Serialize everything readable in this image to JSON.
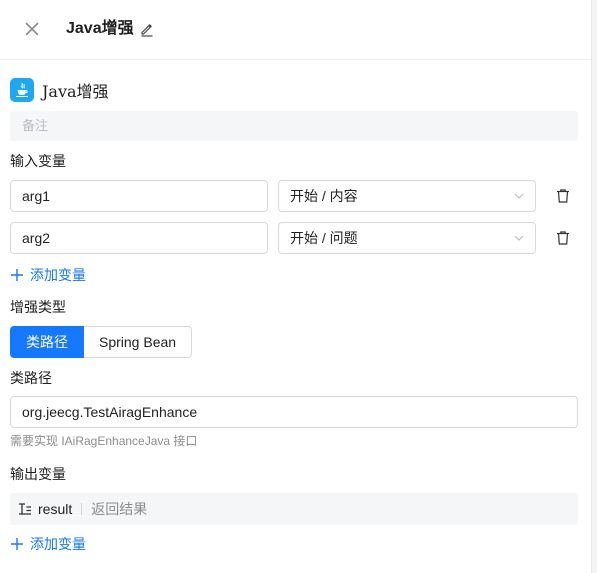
{
  "header": {
    "title": "Java增强"
  },
  "node": {
    "name": "Java增强"
  },
  "remark": {
    "placeholder": "备注"
  },
  "inputs": {
    "label": "输入变量",
    "rows": [
      {
        "name": "arg1",
        "source": "开始 / 内容"
      },
      {
        "name": "arg2",
        "source": "开始 / 问题"
      }
    ],
    "add_label": "添加变量"
  },
  "enhance": {
    "label": "增强类型",
    "options": [
      "类路径",
      "Spring Bean"
    ],
    "selected": "类路径"
  },
  "classpath": {
    "label": "类路径",
    "value": "org.jeecg.TestAiragEnhance",
    "hint": "需要实现 IAiRagEnhanceJava 接口"
  },
  "outputs": {
    "label": "输出变量",
    "rows": [
      {
        "name": "result",
        "description": "返回结果"
      }
    ],
    "add_label": "添加变量"
  },
  "colors": {
    "primary": "#1677ff",
    "node_icon": "#1fa7f0"
  }
}
